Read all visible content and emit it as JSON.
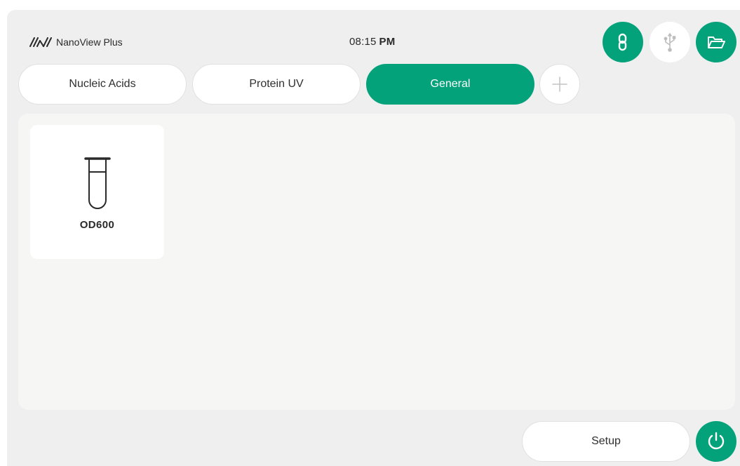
{
  "header": {
    "app_name": "NanoView Plus",
    "time": "08:15",
    "ampm": "PM",
    "buttons": [
      {
        "name": "link-button",
        "icon": "link-icon",
        "style": "green"
      },
      {
        "name": "usb-button",
        "icon": "usb-icon",
        "style": "white-disabled"
      },
      {
        "name": "folder-button",
        "icon": "folder-open-icon",
        "style": "green"
      }
    ]
  },
  "tabs": [
    {
      "label": "Nucleic Acids",
      "active": false
    },
    {
      "label": "Protein UV",
      "active": false
    },
    {
      "label": "General",
      "active": true
    }
  ],
  "add_tab_icon": "plus-icon",
  "apps": [
    {
      "label": "OD600",
      "icon": "test-tube-icon"
    }
  ],
  "footer": {
    "setup_label": "Setup",
    "power_icon": "power-icon"
  },
  "colors": {
    "accent": "#04a27a",
    "background": "#eeefee",
    "panel": "#f6f6f5",
    "text": "#2a2a2a"
  }
}
